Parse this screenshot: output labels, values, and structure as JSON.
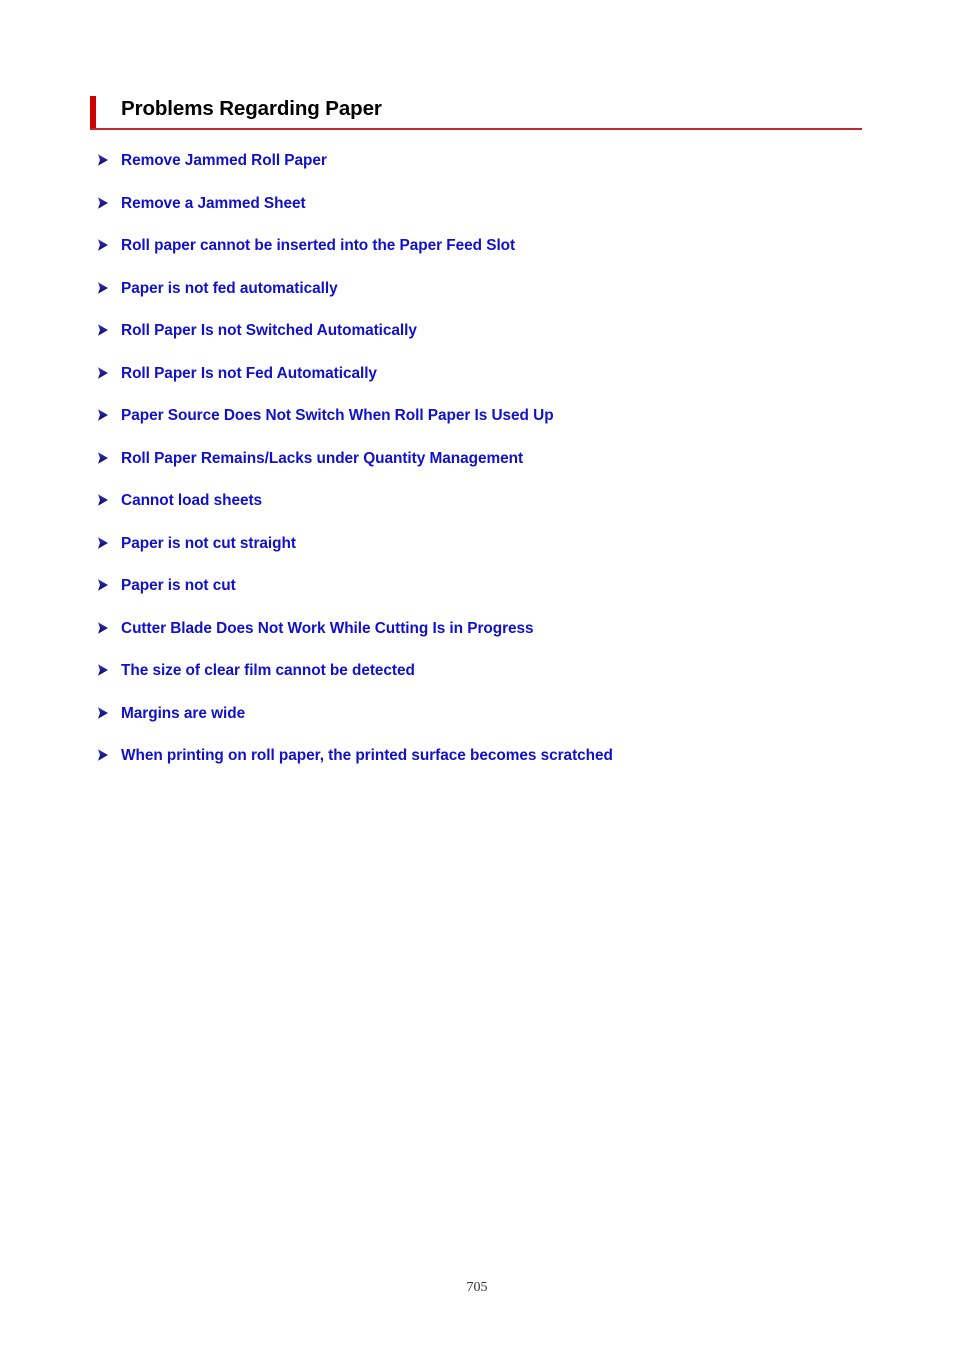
{
  "page": {
    "title": "Problems Regarding Paper",
    "page_number": "705",
    "accent_color": "#cc0000",
    "rule_color": "#c1272d",
    "link_color": "#1111cc",
    "bullet_color": "#1a1a8c",
    "bullet_icon": "triangle-right-icon"
  },
  "links": [
    {
      "label": "Remove Jammed Roll Paper"
    },
    {
      "label": "Remove a Jammed Sheet"
    },
    {
      "label": "Roll paper cannot be inserted into the Paper Feed Slot"
    },
    {
      "label": "Paper is not fed automatically"
    },
    {
      "label": "Roll Paper Is not Switched Automatically"
    },
    {
      "label": "Roll Paper Is not Fed Automatically"
    },
    {
      "label": "Paper Source Does Not Switch When Roll Paper Is Used Up"
    },
    {
      "label": "Roll Paper Remains/Lacks under Quantity Management"
    },
    {
      "label": "Cannot load sheets"
    },
    {
      "label": "Paper is not cut straight"
    },
    {
      "label": "Paper is not cut"
    },
    {
      "label": "Cutter Blade Does Not Work While Cutting Is in Progress"
    },
    {
      "label": "The size of clear film cannot be detected"
    },
    {
      "label": "Margins are wide"
    },
    {
      "label": "When printing on roll paper, the printed surface becomes scratched"
    }
  ]
}
